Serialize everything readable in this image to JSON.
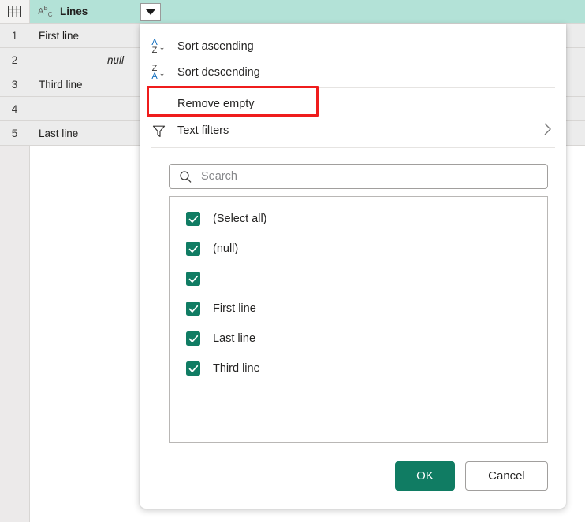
{
  "grid": {
    "corner_icon": "table-grid-icon",
    "column": {
      "type_icon": "abc-text-type-icon",
      "name": "Lines",
      "dropdown_icon": "caret-down-icon"
    },
    "rows": [
      {
        "num": "1",
        "value": "First line"
      },
      {
        "num": "2",
        "value": "null"
      },
      {
        "num": "3",
        "value": "Third line"
      },
      {
        "num": "4",
        "value": ""
      },
      {
        "num": "5",
        "value": "Last line"
      }
    ]
  },
  "menu": {
    "items": [
      {
        "label": "Sort ascending",
        "icon": "sort-ascending-az-icon"
      },
      {
        "label": "Sort descending",
        "icon": "sort-descending-za-icon"
      },
      {
        "label": "Remove empty",
        "icon": "none",
        "highlighted": true
      },
      {
        "label": "Text filters",
        "icon": "funnel-icon",
        "submenu_icon": "chevron-right-icon"
      }
    ],
    "sort_ascending_glyph": {
      "top": "A",
      "bottom": "Z",
      "arrow": "↓"
    },
    "sort_descending_glyph": {
      "top": "Z",
      "bottom": "A",
      "arrow": "↓"
    },
    "submenu_chevron": "›"
  },
  "search": {
    "icon": "search-icon",
    "placeholder": "Search",
    "value": ""
  },
  "filter_list": {
    "items": [
      {
        "label": "(Select all)",
        "checked": true
      },
      {
        "label": "(null)",
        "checked": true
      },
      {
        "label": "",
        "checked": true
      },
      {
        "label": "First line",
        "checked": true
      },
      {
        "label": "Last line",
        "checked": true
      },
      {
        "label": "Third line",
        "checked": true
      }
    ]
  },
  "footer": {
    "ok_label": "OK",
    "cancel_label": "Cancel"
  },
  "colors": {
    "accent_teal": "#107C63",
    "header_teal": "#B3E2D7",
    "annotation_red": "#EF1C1C",
    "sort_blue": "#0F6CBD"
  }
}
